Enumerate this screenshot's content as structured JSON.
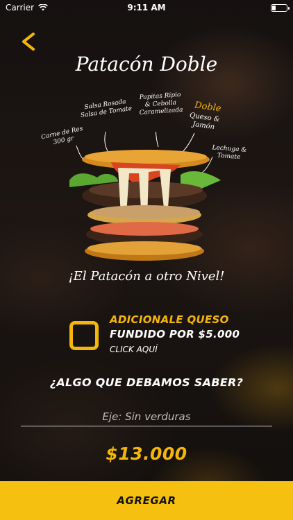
{
  "status_bar": {
    "carrier": "Carrier",
    "time": "9:11 AM"
  },
  "product": {
    "title": "Patacón Doble",
    "annotations": {
      "carne": "Carne de Res\n300 gr",
      "salsa": "Salsa Rosada\nSalsa de Tomate",
      "papitas": "Papitas Ripio\n& Cebolla\nCaramelizada",
      "doble_title": "Doble",
      "doble_sub": "Queso &\nJamón",
      "lechuga": "Lechuga &\nTomate"
    },
    "slogan": "¡El Patacón a otro Nivel!"
  },
  "extra_option": {
    "line1": "ADICIONALE QUESO",
    "line2": "FUNDIDO POR $5.000",
    "line3": "CLICK AQUÍ"
  },
  "notes": {
    "question": "¿ALGO QUE DEBAMOS SABER?",
    "placeholder": "Eje: Sin verduras",
    "value": ""
  },
  "price": "$13.000",
  "add_button": "AGREGAR",
  "colors": {
    "accent": "#f5b60a",
    "button_bg": "#f5c00f",
    "background": "#151110"
  }
}
